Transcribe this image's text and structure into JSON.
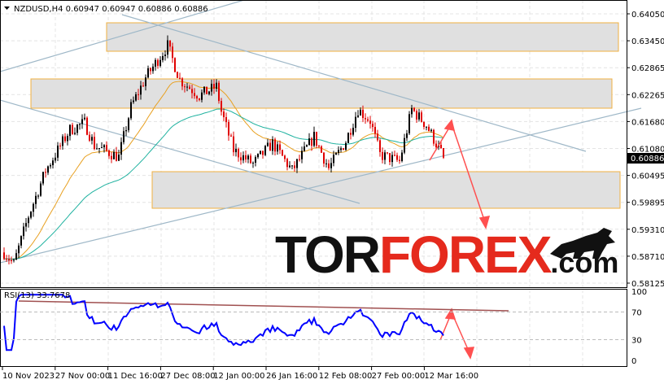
{
  "header": {
    "symbol": "NZDUSD,H4",
    "open": "0.60947",
    "high": "0.60947",
    "low": "0.60886",
    "close": "0.60886"
  },
  "price_axis": [
    "0.64050",
    "0.63450",
    "0.62865",
    "0.62265",
    "0.61680",
    "0.61080",
    "0.60495",
    "0.59895",
    "0.59310",
    "0.58710",
    "0.58125"
  ],
  "current_price": "0.60886",
  "rsi": {
    "label": "RSI(13) 33.7678",
    "axis": [
      "100",
      "70",
      "30",
      "0"
    ]
  },
  "time_axis": [
    "10 Nov 2023",
    "27 Nov 00:00",
    "11 Dec 16:00",
    "27 Dec 08:00",
    "12 Jan 00:00",
    "26 Jan 16:00",
    "12 Feb 08:00",
    "27 Feb 00:00",
    "12 Mar 16:00"
  ],
  "logo": {
    "part1": "TOR",
    "part2": "FOREX",
    ".com": ".com"
  },
  "colors": {
    "bull": "#000000",
    "bear": "#e00000",
    "ma_fast": "#e8a020",
    "ma_slow": "#20b2a0",
    "rsi": "#0000ff",
    "arrow": "#ff4040",
    "zone_border": "#f0b040"
  },
  "chart_data": {
    "type": "candlestick",
    "price_path": [
      [
        0,
        0.588
      ],
      [
        4,
        0.5855
      ],
      [
        10,
        0.596
      ],
      [
        17,
        0.606
      ],
      [
        27,
        0.615
      ],
      [
        33,
        0.6165
      ],
      [
        37,
        0.6115
      ],
      [
        47,
        0.609
      ],
      [
        52,
        0.62
      ],
      [
        58,
        0.6265
      ],
      [
        67,
        0.6335
      ],
      [
        72,
        0.626
      ],
      [
        80,
        0.6225
      ],
      [
        87,
        0.6245
      ],
      [
        89,
        0.619
      ],
      [
        94,
        0.6105
      ],
      [
        102,
        0.6075
      ],
      [
        110,
        0.612
      ],
      [
        118,
        0.606
      ],
      [
        127,
        0.6135
      ],
      [
        133,
        0.6065
      ],
      [
        140,
        0.6125
      ],
      [
        145,
        0.6195
      ],
      [
        150,
        0.617
      ],
      [
        154,
        0.6095
      ],
      [
        162,
        0.608
      ],
      [
        167,
        0.6195
      ],
      [
        173,
        0.616
      ],
      [
        177,
        0.612
      ],
      [
        180,
        0.6089
      ]
    ],
    "ylim": [
      0.58125,
      0.6405
    ],
    "rsi_levels": [
      30,
      70
    ]
  }
}
